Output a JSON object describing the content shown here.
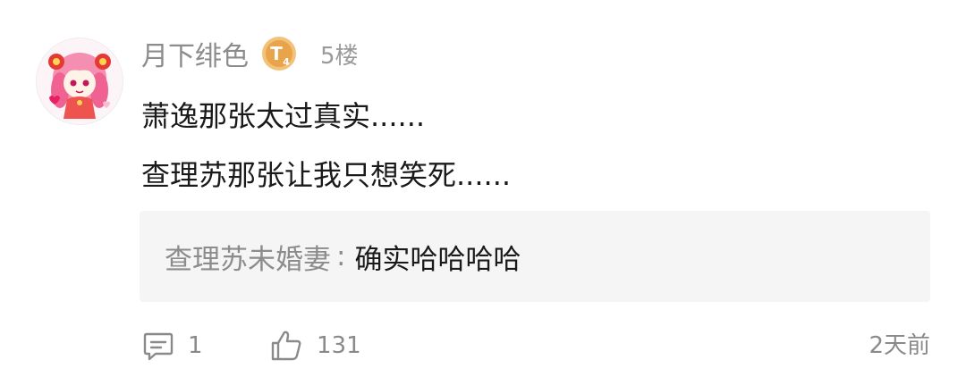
{
  "comment": {
    "username": "月下绯色",
    "level_badge": "T4",
    "floor": "5楼",
    "lines": [
      "萧逸那张太过真实......",
      "查理苏那张让我只想笑死......"
    ]
  },
  "reply": {
    "author": "查理苏未婚妻",
    "separator": ":",
    "text": "确实哈哈哈哈"
  },
  "footer": {
    "reply_count": "1",
    "like_count": "131",
    "time": "2天前"
  },
  "icons": {
    "reply": "comment-bubble-icon",
    "like": "thumbs-up-icon",
    "badge_color": "#e8a34b"
  }
}
